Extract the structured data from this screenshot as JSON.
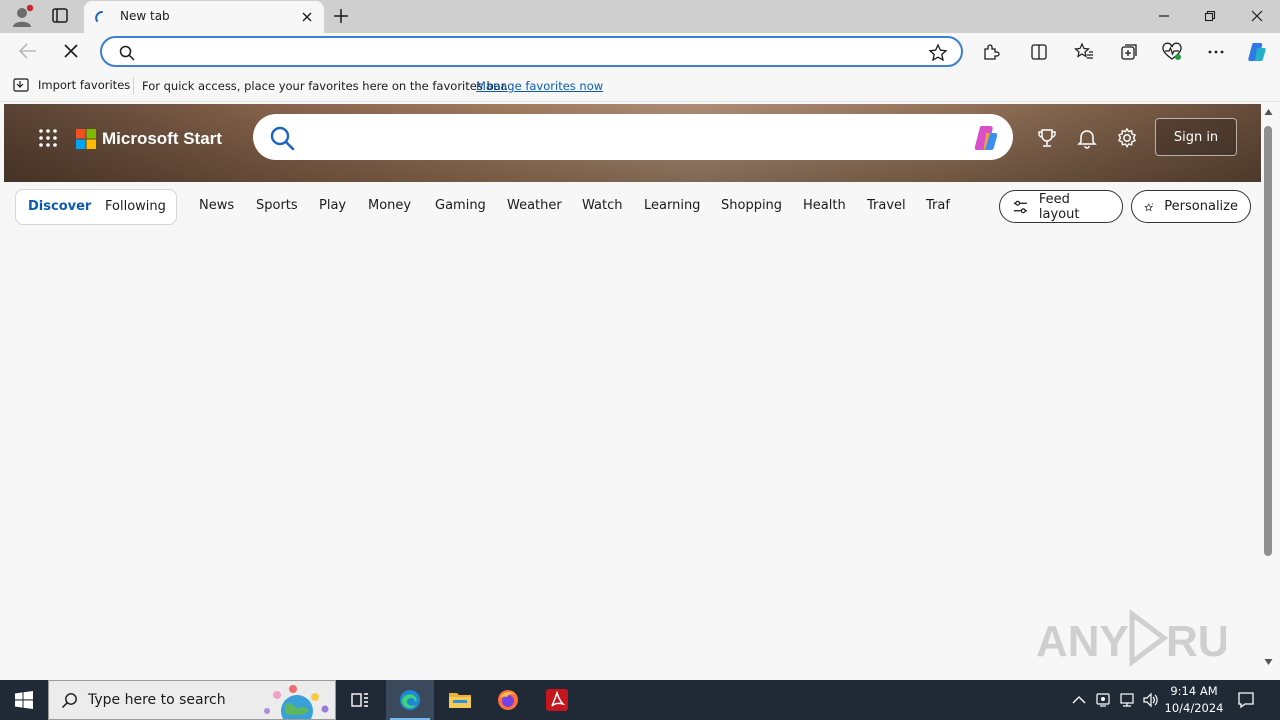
{
  "browser": {
    "tab_title": "New tab",
    "address_value": "",
    "address_placeholder": "",
    "favorites_bar": {
      "import_label": "Import favorites",
      "message": "For quick access, place your favorites here on the favorites bar.",
      "manage_link": "Manage favorites now"
    }
  },
  "page": {
    "brand": "Microsoft Start",
    "search_value": "",
    "sign_in_label": "Sign in",
    "feed_tabs": {
      "discover": "Discover",
      "following": "Following"
    },
    "nav_items": [
      "News",
      "Sports",
      "Play",
      "Money",
      "Gaming",
      "Weather",
      "Watch",
      "Learning",
      "Shopping",
      "Health",
      "Travel",
      "Traf"
    ],
    "feed_layout_label": "Feed layout",
    "personalize_label": "Personalize"
  },
  "watermark": "ANY RUN",
  "taskbar": {
    "search_placeholder": "Type here to search",
    "time": "9:14 AM",
    "date": "10/4/2024"
  },
  "colors": {
    "accent": "#0b5cad",
    "omnibox_border": "#3b7fd4",
    "taskbar": "#1f2a36"
  }
}
